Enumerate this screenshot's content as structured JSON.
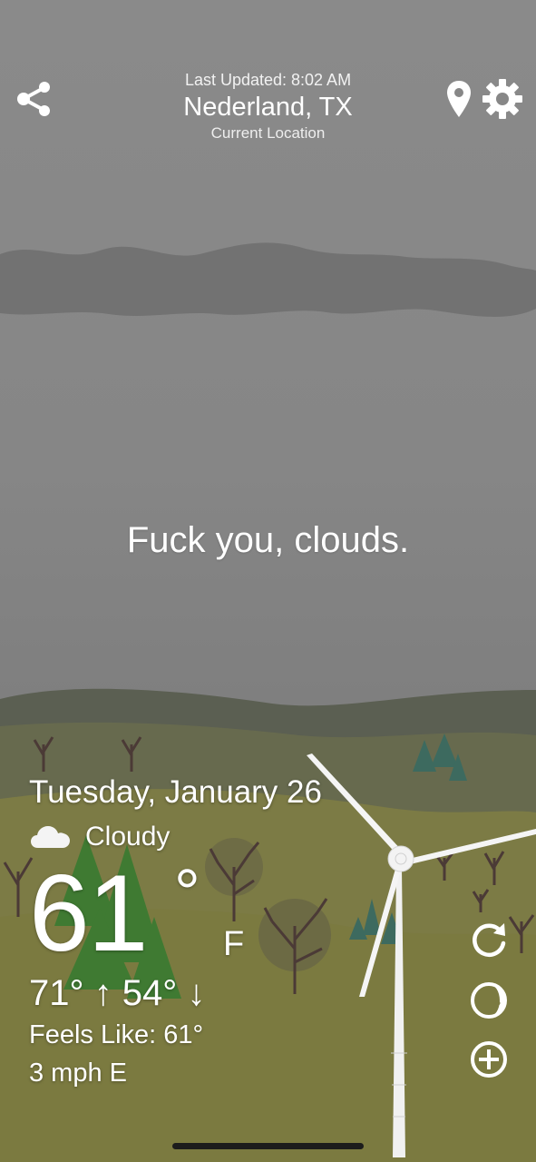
{
  "header": {
    "last_updated": "Last Updated: 8:02 AM",
    "city": "Nederland, TX",
    "location_label": "Current Location",
    "icons": [
      "share-icon",
      "location-pin-icon",
      "gear-icon"
    ]
  },
  "message": "Fuck you, clouds.",
  "weather": {
    "date": "Tuesday, January 26",
    "condition": "Cloudy",
    "condition_icon": "cloud-icon",
    "temperature": "61",
    "degree_symbol": "°",
    "unit": "F",
    "high_low": "71° ↑ 54° ↓",
    "feels_like": "Feels Like: 61°",
    "wind": "3 mph E"
  },
  "side_buttons": [
    "refresh-icon",
    "moon-phase-icon",
    "add-icon"
  ],
  "colors": {
    "sky": "#878787",
    "cloud_band": "#6e6e6e",
    "hill_far": "#59604f",
    "hill_near": "#7a7a44",
    "tree_green": "#3f7a32",
    "text": "#ffffff"
  }
}
